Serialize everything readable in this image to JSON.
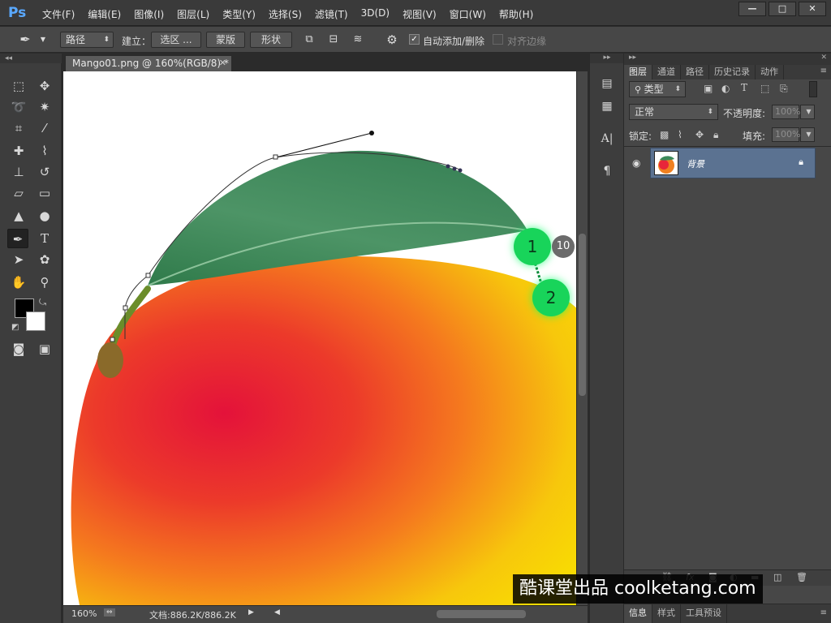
{
  "app": {
    "logo": "Ps",
    "menu": [
      "文件(F)",
      "编辑(E)",
      "图像(I)",
      "图层(L)",
      "类型(Y)",
      "选择(S)",
      "滤镜(T)",
      "3D(D)",
      "视图(V)",
      "窗口(W)",
      "帮助(H)"
    ]
  },
  "options_bar": {
    "mode_select": "路径",
    "make_label": "建立：",
    "selection_btn": "选区 ...",
    "mask_btn": "蒙版",
    "shape_btn": "形状",
    "auto_add_label": "自动添加/删除",
    "auto_add_checked": true,
    "align_edges_label": "对齐边缘",
    "align_edges_checked": false
  },
  "document": {
    "tab_title": "Mango01.png @ 160%(RGB/8) *",
    "zoom": "160%",
    "doc_info": "文档:886.2K/886.2K"
  },
  "layers_panel": {
    "tabs": [
      "图层",
      "通道",
      "路径",
      "历史记录",
      "动作"
    ],
    "active_tab": "图层",
    "filter_label": "类型",
    "blend_mode": "正常",
    "opacity_label": "不透明度:",
    "opacity_value": "100%",
    "lock_label": "锁定:",
    "fill_label": "填充:",
    "fill_value": "100%",
    "layer_name": "背景"
  },
  "bottom_tabs": [
    "信息",
    "样式",
    "工具预设"
  ],
  "markers": {
    "step1": "1",
    "step2": "2",
    "badge": "10"
  },
  "watermark": "酷课堂出品 coolketang.com",
  "colors": {
    "accent_step": "#18d45a",
    "layer_selected": "#5b7291",
    "leaf": "#3c8a5a",
    "mango_red": "#e8263a",
    "mango_yellow": "#f8d800"
  }
}
